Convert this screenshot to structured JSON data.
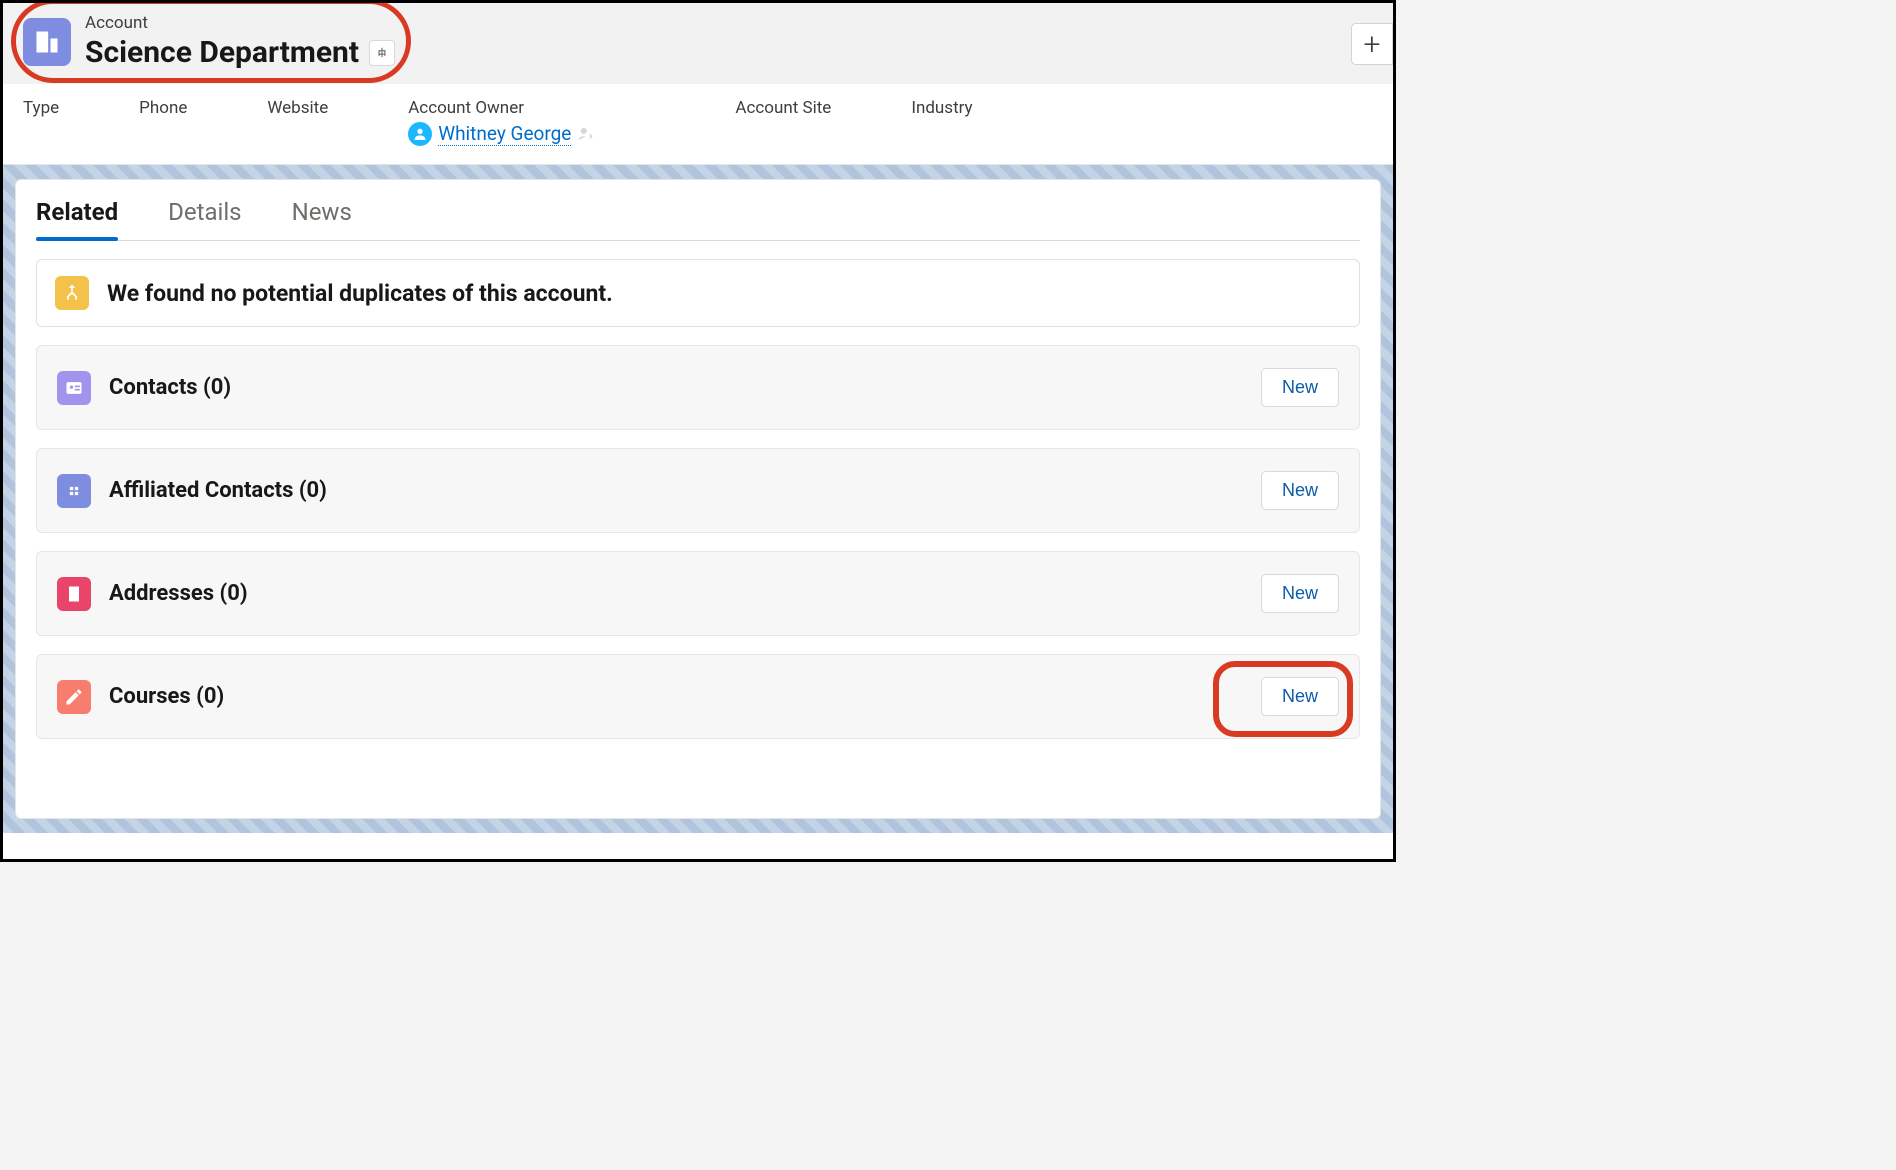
{
  "header": {
    "object_label": "Account",
    "title": "Science Department"
  },
  "fields": {
    "type_label": "Type",
    "phone_label": "Phone",
    "website_label": "Website",
    "owner_label": "Account Owner",
    "owner_name": "Whitney George",
    "site_label": "Account Site",
    "industry_label": "Industry"
  },
  "tabs": {
    "related": "Related",
    "details": "Details",
    "news": "News"
  },
  "duplicate_notice": "We found no potential duplicates of this account.",
  "new_button_label": "New",
  "related_lists": [
    {
      "title": "Contacts (0)"
    },
    {
      "title": "Affiliated Contacts (0)"
    },
    {
      "title": "Addresses (0)"
    },
    {
      "title": "Courses (0)"
    }
  ]
}
